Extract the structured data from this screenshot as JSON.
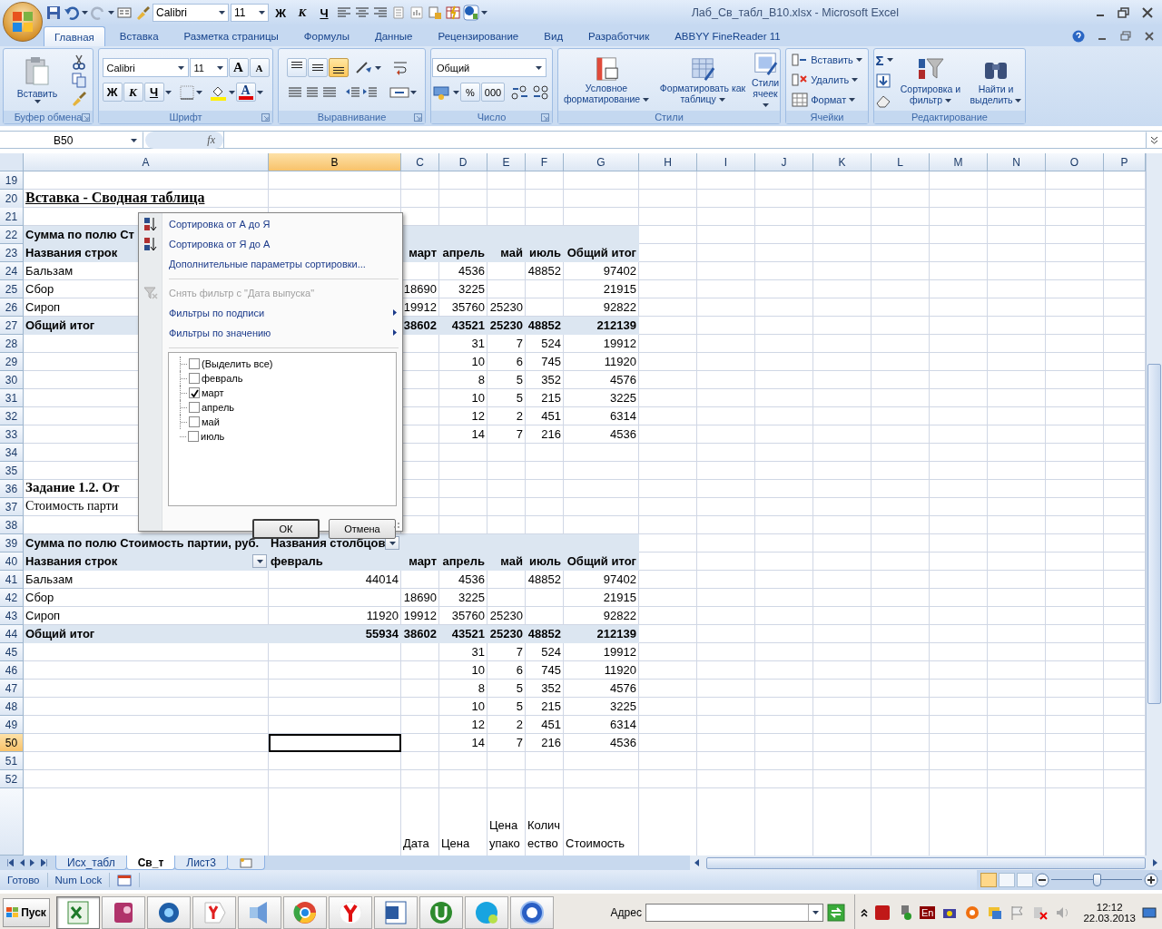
{
  "window": {
    "title": "Лаб_Св_табл_В10.xlsx - Microsoft Excel"
  },
  "quick_access": {
    "font": "Calibri",
    "size": "11",
    "bold": "Ж",
    "italic": "К",
    "underline": "Ч"
  },
  "ribbon": {
    "tabs": [
      {
        "label": "Главная",
        "selected": true
      },
      {
        "label": "Вставка",
        "selected": false
      },
      {
        "label": "Разметка страницы",
        "selected": false
      },
      {
        "label": "Формулы",
        "selected": false
      },
      {
        "label": "Данные",
        "selected": false
      },
      {
        "label": "Рецензирование",
        "selected": false
      },
      {
        "label": "Вид",
        "selected": false
      },
      {
        "label": "Разработчик",
        "selected": false
      },
      {
        "label": "ABBYY FineReader 11",
        "selected": false
      }
    ],
    "groups": [
      {
        "kind": "clipboard",
        "title": "Буфер обмена",
        "paste": "Вставить"
      },
      {
        "kind": "font",
        "title": "Шрифт",
        "font": "Calibri",
        "size": "11",
        "grow": "A",
        "shrink": "A",
        "bold": "Ж",
        "italic": "К",
        "underline": "Ч",
        "font_color_label": "A"
      },
      {
        "kind": "alignment",
        "title": "Выравнивание",
        "vertical": [
          {
            "selected": false
          },
          {
            "selected": false
          },
          {
            "selected": true
          }
        ]
      },
      {
        "kind": "number",
        "title": "Число",
        "format": "Общий",
        "percent": "%",
        "thousands": "000"
      },
      {
        "kind": "styles",
        "title": "Стили",
        "buttons": [
          "Условное форматирование",
          "Форматировать как таблицу",
          "Стили ячеек"
        ]
      },
      {
        "kind": "cells",
        "title": "Ячейки",
        "buttons": [
          "Вставить",
          "Удалить",
          "Формат"
        ]
      },
      {
        "kind": "editing",
        "title": "Редактирование",
        "sum": "Σ",
        "buttons": [
          "Сортировка и фильтр",
          "Найти и выделить"
        ]
      }
    ]
  },
  "formula_bar": {
    "name_box": "B50",
    "fx": "fx"
  },
  "sheet": {
    "columns": [
      {
        "label": "A",
        "selected": false
      },
      {
        "label": "B",
        "selected": true
      },
      {
        "label": "C",
        "selected": false
      },
      {
        "label": "D",
        "selected": false
      },
      {
        "label": "E",
        "selected": false
      },
      {
        "label": "F",
        "selected": false
      },
      {
        "label": "G",
        "selected": false
      },
      {
        "label": "H",
        "selected": false
      },
      {
        "label": "I",
        "selected": false
      },
      {
        "label": "J",
        "selected": false
      },
      {
        "label": "K",
        "selected": false
      },
      {
        "label": "L",
        "selected": false
      },
      {
        "label": "M",
        "selected": false
      },
      {
        "label": "N",
        "selected": false
      },
      {
        "label": "O",
        "selected": false
      },
      {
        "label": "P",
        "selected": false
      }
    ],
    "rows": [
      {
        "num": "19",
        "selected": false,
        "kind": "empty"
      },
      {
        "num": "20",
        "selected": false,
        "kind": "title",
        "cells": {
          "A": "Вставка - Сводная таблица"
        }
      },
      {
        "num": "21",
        "selected": false,
        "kind": "empty"
      },
      {
        "num": "22",
        "selected": false,
        "kind": "pivot-header",
        "cells": {
          "A": "Сумма по полю Ст"
        }
      },
      {
        "num": "23",
        "selected": false,
        "kind": "pivot-header",
        "cells": {
          "A": "Названия строк",
          "C": "март",
          "D": "апрель",
          "E": "май",
          "F": "июль",
          "G": "Общий итог"
        }
      },
      {
        "num": "24",
        "selected": false,
        "kind": "data",
        "cells": {
          "A": "Бальзам",
          "D": "4536",
          "F": "48852",
          "G": "97402"
        }
      },
      {
        "num": "25",
        "selected": false,
        "kind": "data",
        "cells": {
          "A": "Сбор",
          "C": "18690",
          "D": "3225",
          "G": "21915"
        }
      },
      {
        "num": "26",
        "selected": false,
        "kind": "data",
        "cells": {
          "A": "Сироп",
          "C": "19912",
          "D": "35760",
          "E": "25230",
          "G": "92822"
        }
      },
      {
        "num": "27",
        "selected": false,
        "kind": "pivot-total",
        "cells": {
          "A": "Общий итог",
          "C": "38602",
          "D": "43521",
          "E": "25230",
          "F": "48852",
          "G": "212139"
        }
      },
      {
        "num": "28",
        "selected": false,
        "kind": "data",
        "cells": {
          "D": "31",
          "E": "7",
          "F": "524",
          "G": "19912"
        }
      },
      {
        "num": "29",
        "selected": false,
        "kind": "data",
        "cells": {
          "D": "10",
          "E": "6",
          "F": "745",
          "G": "11920"
        }
      },
      {
        "num": "30",
        "selected": false,
        "kind": "data",
        "cells": {
          "D": "8",
          "E": "5",
          "F": "352",
          "G": "4576"
        }
      },
      {
        "num": "31",
        "selected": false,
        "kind": "data",
        "cells": {
          "D": "10",
          "E": "5",
          "F": "215",
          "G": "3225"
        }
      },
      {
        "num": "32",
        "selected": false,
        "kind": "data",
        "cells": {
          "D": "12",
          "E": "2",
          "F": "451",
          "G": "6314"
        }
      },
      {
        "num": "33",
        "selected": false,
        "kind": "data",
        "cells": {
          "D": "14",
          "E": "7",
          "F": "216",
          "G": "4536"
        }
      },
      {
        "num": "34",
        "selected": false,
        "kind": "empty"
      },
      {
        "num": "35",
        "selected": false,
        "kind": "empty"
      },
      {
        "num": "36",
        "selected": false,
        "kind": "subtitle",
        "cells": {
          "A": "Задание 1.2. От"
        }
      },
      {
        "num": "37",
        "selected": false,
        "kind": "note",
        "cells": {
          "A": "Стоимость парти"
        }
      },
      {
        "num": "38",
        "selected": false,
        "kind": "empty"
      },
      {
        "num": "39",
        "selected": false,
        "kind": "pivot-header",
        "cells": {
          "A": "Сумма по полю  Стоимость партии, руб.",
          "B": {
            "text": "Названия столбцов",
            "dropdown": true
          }
        }
      },
      {
        "num": "40",
        "selected": false,
        "kind": "pivot-header",
        "cells": {
          "A": {
            "text": "Названия строк",
            "dropdown": true
          },
          "B": "февраль",
          "C": "март",
          "D": "апрель",
          "E": "май",
          "F": "июль",
          "G": "Общий итог"
        }
      },
      {
        "num": "41",
        "selected": false,
        "kind": "data",
        "cells": {
          "A": "Бальзам",
          "B": "44014",
          "D": "4536",
          "F": "48852",
          "G": "97402"
        }
      },
      {
        "num": "42",
        "selected": false,
        "kind": "data",
        "cells": {
          "A": "Сбор",
          "C": "18690",
          "D": "3225",
          "G": "21915"
        }
      },
      {
        "num": "43",
        "selected": false,
        "kind": "data",
        "cells": {
          "A": "Сироп",
          "B": "11920",
          "C": "19912",
          "D": "35760",
          "E": "25230",
          "G": "92822"
        }
      },
      {
        "num": "44",
        "selected": false,
        "kind": "pivot-total",
        "cells": {
          "A": "Общий итог",
          "B": "55934",
          "C": "38602",
          "D": "43521",
          "E": "25230",
          "F": "48852",
          "G": "212139"
        }
      },
      {
        "num": "45",
        "selected": false,
        "kind": "data",
        "cells": {
          "D": "31",
          "E": "7",
          "F": "524",
          "G": "19912"
        }
      },
      {
        "num": "46",
        "selected": false,
        "kind": "data",
        "cells": {
          "D": "10",
          "E": "6",
          "F": "745",
          "G": "11920"
        }
      },
      {
        "num": "47",
        "selected": false,
        "kind": "data",
        "cells": {
          "D": "8",
          "E": "5",
          "F": "352",
          "G": "4576"
        }
      },
      {
        "num": "48",
        "selected": false,
        "kind": "data",
        "cells": {
          "D": "10",
          "E": "5",
          "F": "215",
          "G": "3225"
        }
      },
      {
        "num": "49",
        "selected": false,
        "kind": "data",
        "cells": {
          "D": "12",
          "E": "2",
          "F": "451",
          "G": "6314"
        }
      },
      {
        "num": "50",
        "selected": true,
        "kind": "data",
        "cells": {
          "D": "14",
          "E": "7",
          "F": "216",
          "G": "4536"
        }
      },
      {
        "num": "51",
        "selected": false,
        "kind": "empty"
      },
      {
        "num": "52",
        "selected": false,
        "kind": "empty"
      },
      {
        "selected": false,
        "kind": "wrap-header",
        "cells": {
          "C": "Дата",
          "D": "Цена",
          "E": "Цена упако",
          "F": "Количество",
          "G": "Стоимость"
        }
      }
    ]
  },
  "sheet_tabs": [
    {
      "label": "Исх_табл",
      "selected": false
    },
    {
      "label": "Св_т",
      "selected": true
    },
    {
      "label": "Лист3",
      "selected": false
    }
  ],
  "filter_menu": {
    "items": [
      {
        "kind": "sort-asc",
        "label": "Сортировка от А до Я",
        "disabled": false
      },
      {
        "kind": "sort-desc",
        "label": "Сортировка от Я до А",
        "disabled": false
      },
      {
        "kind": "plain",
        "label": "Дополнительные параметры сортировки...",
        "disabled": false
      },
      {
        "kind": "separator"
      },
      {
        "kind": "clear-filter",
        "label": "Снять фильтр с \"Дата выпуска\"",
        "disabled": true
      },
      {
        "kind": "submenu",
        "label": "Фильтры по подписи",
        "disabled": false
      },
      {
        "kind": "submenu",
        "label": "Фильтры по значению",
        "disabled": false
      },
      {
        "kind": "separator"
      }
    ],
    "options": [
      {
        "label": "(Выделить все)",
        "checked": false
      },
      {
        "label": "февраль",
        "checked": false
      },
      {
        "label": "март",
        "checked": true
      },
      {
        "label": "апрель",
        "checked": false
      },
      {
        "label": "май",
        "checked": false
      },
      {
        "label": "июль",
        "checked": false
      }
    ],
    "buttons": [
      "ОК",
      "Отмена"
    ]
  },
  "status_bar": {
    "mode": "Готово",
    "num_lock": "Num Lock",
    "zoom": {
      "level": 0.5
    }
  },
  "taskbar": {
    "start": "Пуск",
    "apps": [
      {
        "active": true
      },
      {
        "active": false
      },
      {
        "active": false
      },
      {
        "active": false
      },
      {
        "active": false
      },
      {
        "active": false
      },
      {
        "active": false
      },
      {
        "active": false
      },
      {
        "active": false
      },
      {
        "active": false
      },
      {
        "active": false
      }
    ],
    "address_label": "Адрес",
    "language": "En",
    "time": "12:12",
    "date": "22.03.2013"
  }
}
